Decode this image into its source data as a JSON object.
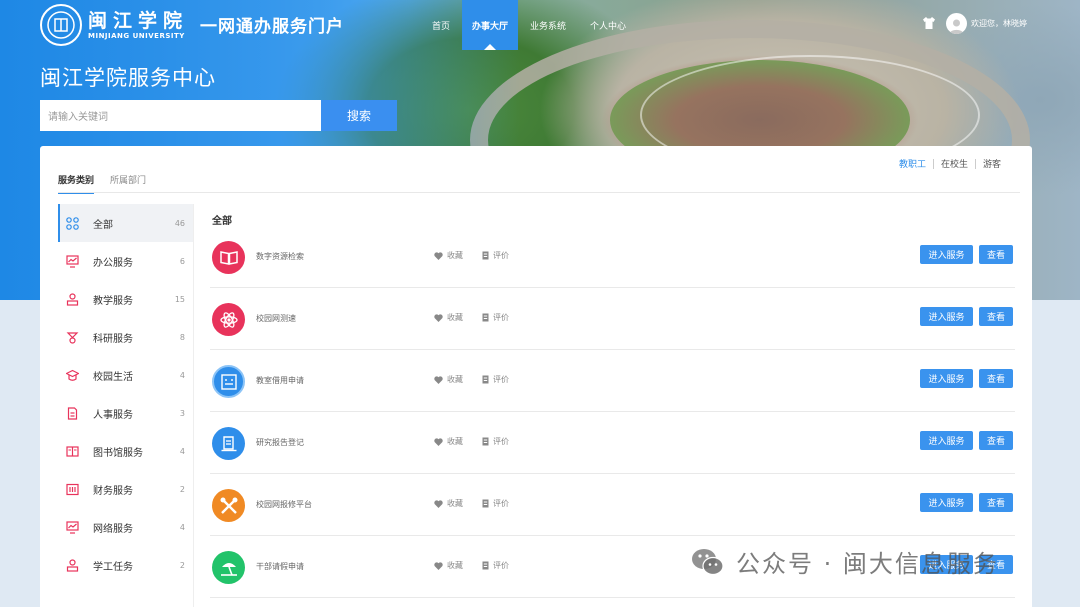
{
  "brand": {
    "school_cn": "闽江学院",
    "school_en": "MINJIANG UNIVERSITY",
    "portal_title": "一网通办服务门户"
  },
  "nav": {
    "items": [
      {
        "label": "首页",
        "active": false
      },
      {
        "label": "办事大厅",
        "active": true
      },
      {
        "label": "业务系统",
        "active": false
      },
      {
        "label": "个人中心",
        "active": false
      }
    ],
    "user_greeting": "欢迎您，林晓婷"
  },
  "hero": {
    "title": "闽江学院服务中心",
    "search_placeholder": "请输入关键词",
    "search_button": "搜索"
  },
  "tabs": [
    {
      "label": "服务类别",
      "active": true
    },
    {
      "label": "所属部门",
      "active": false
    }
  ],
  "roles": [
    {
      "label": "教职工",
      "active": true
    },
    {
      "label": "在校生",
      "active": false
    },
    {
      "label": "游客",
      "active": false
    }
  ],
  "sidebar": {
    "items": [
      {
        "label": "全部",
        "count": "46",
        "icon": "grid-icon",
        "active": true
      },
      {
        "label": "办公服务",
        "count": "6",
        "icon": "chart-icon",
        "active": false
      },
      {
        "label": "教学服务",
        "count": "15",
        "icon": "teacher-icon",
        "active": false
      },
      {
        "label": "科研服务",
        "count": "8",
        "icon": "research-icon",
        "active": false
      },
      {
        "label": "校园生活",
        "count": "4",
        "icon": "graduation-cap-icon",
        "active": false
      },
      {
        "label": "人事服务",
        "count": "3",
        "icon": "document-icon",
        "active": false
      },
      {
        "label": "图书馆服务",
        "count": "4",
        "icon": "book-icon",
        "active": false
      },
      {
        "label": "财务服务",
        "count": "2",
        "icon": "finance-icon",
        "active": false
      },
      {
        "label": "网络服务",
        "count": "4",
        "icon": "network-chart-icon",
        "active": false
      },
      {
        "label": "学工任务",
        "count": "2",
        "icon": "student-work-icon",
        "active": false
      }
    ]
  },
  "content": {
    "section_title": "全部",
    "fav_label": "收藏",
    "rate_label": "评价",
    "enter_label": "进入服务",
    "view_label": "查看",
    "services": [
      {
        "name": "数字资源检索",
        "icon": "book-open-icon",
        "color": "#e8335b"
      },
      {
        "name": "校园网测速",
        "icon": "atom-icon",
        "color": "#e8335b"
      },
      {
        "name": "教室借用申请",
        "icon": "classroom-icon",
        "color": "#2f8eea"
      },
      {
        "name": "研究报告登记",
        "icon": "report-icon",
        "color": "#2f8eea"
      },
      {
        "name": "校园网报修平台",
        "icon": "tools-icon",
        "color": "#f08a24"
      },
      {
        "name": "干部请假申请",
        "icon": "leave-icon",
        "color": "#22c36a"
      }
    ]
  },
  "watermark": {
    "text": "公众号 · 闽大信息服务"
  },
  "colors": {
    "accent": "#2f8eea",
    "button": "#3a93ee",
    "sidebar_icon": "#e8335b"
  }
}
